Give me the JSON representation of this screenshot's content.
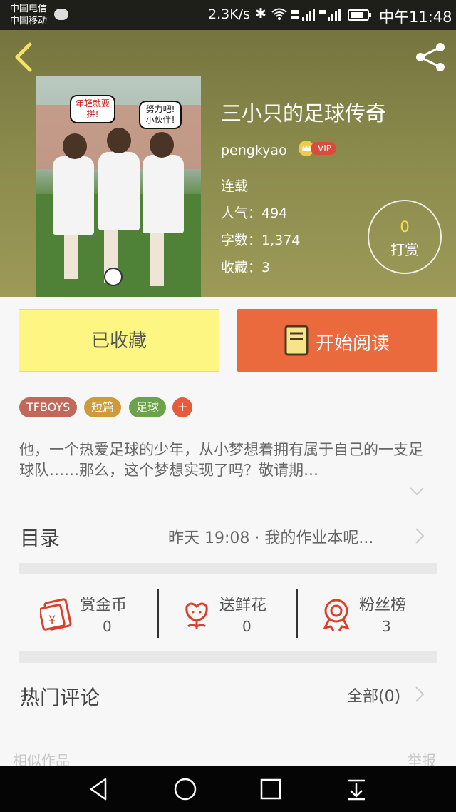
{
  "status_bar": {
    "carrier1": "中国电信",
    "carrier2": "中国移动",
    "speed": "2.3K/s",
    "clock": "中午11:48"
  },
  "book": {
    "title": "三小只的足球传奇",
    "author": "pengkyao",
    "vip_label": "VIP",
    "status": "连载",
    "popularity": "人气：494",
    "word_count": "字数：1,374",
    "favorites": "收藏：3",
    "tip_count": "0",
    "tip_label": "打赏",
    "cover_bubble_left": "年轻就要拼!",
    "cover_bubble_right": "努力吧!小伙伴!"
  },
  "actions": {
    "favorited_label": "已收藏",
    "read_label": "开始阅读"
  },
  "tags": [
    {
      "label": "TFBOYS",
      "color": "#c0695a"
    },
    {
      "label": "短篇",
      "color": "#cf9a3a"
    },
    {
      "label": "足球",
      "color": "#6aa34a"
    }
  ],
  "tag_add_label": "+",
  "description": "他，一个热爱足球的少年，从小梦想着拥有属于自己的一支足球队……那么，这个梦想实现了吗？敬请期…",
  "toc": {
    "label": "目录",
    "latest": "昨天 19:08 · 我的作业本呢..."
  },
  "stats": [
    {
      "label": "赏金币",
      "value": "0",
      "icon": "red-envelope-icon"
    },
    {
      "label": "送鲜花",
      "value": "0",
      "icon": "flower-icon"
    },
    {
      "label": "粉丝榜",
      "value": "3",
      "icon": "medal-icon"
    }
  ],
  "comments": {
    "label": "热门评论",
    "all": "全部(0)"
  },
  "footer": {
    "similar": "相似作品",
    "report": "举报"
  },
  "colors": {
    "accent": "#ea6a3d",
    "favorite_bg": "#fdf683",
    "icon_red": "#d8412c"
  }
}
